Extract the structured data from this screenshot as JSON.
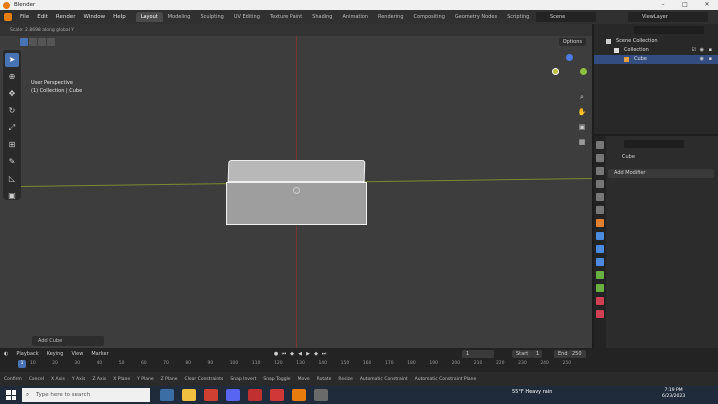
{
  "window": {
    "title": "Blender"
  },
  "menu": {
    "items": [
      "File",
      "Edit",
      "Render",
      "Window",
      "Help"
    ]
  },
  "workspaces": [
    "Layout",
    "Modeling",
    "Sculpting",
    "UV Editing",
    "Texture Paint",
    "Shading",
    "Animation",
    "Rendering",
    "Compositing",
    "Geometry Nodes",
    "Scripting"
  ],
  "scene": "Scene",
  "view_layer": "ViewLayer",
  "viewport": {
    "hint": "Scale: 2.8698 along global Y",
    "view_name": "User Perspective",
    "collection_label": "(1) Collection | Cube",
    "options": "Options",
    "last_operator": "Add Cube"
  },
  "outliner": {
    "rows": [
      "Scene Collection",
      "Collection",
      "Cube"
    ]
  },
  "properties": {
    "object_name": "Cube",
    "add_modifier": "Add Modifier"
  },
  "timeline": {
    "menus": [
      "Playback",
      "Keying",
      "View",
      "Marker"
    ],
    "current_frame": "1",
    "start_label": "Start",
    "start": "1",
    "end_label": "End",
    "end": "250",
    "ticks": [
      "10",
      "20",
      "30",
      "40",
      "50",
      "60",
      "70",
      "80",
      "90",
      "100",
      "110",
      "120",
      "130",
      "140",
      "150",
      "160",
      "170",
      "180",
      "190",
      "200",
      "210",
      "220",
      "230",
      "240",
      "250"
    ]
  },
  "statusbar": [
    "Confirm",
    "Cancel",
    "X Axis",
    "Y Axis",
    "Z Axis",
    "X Plane",
    "Y Plane",
    "Z Plane",
    "Clear Constraints",
    "Snap Invert",
    "Snap Toggle",
    "Move",
    "Rotate",
    "Resize",
    "Automatic Constraint",
    "Automatic Constraint Plane"
  ],
  "taskbar": {
    "search_placeholder": "Type here to search",
    "weather": "55°F  Heavy rain",
    "time": "7:19 PM",
    "date": "6/23/2023"
  }
}
